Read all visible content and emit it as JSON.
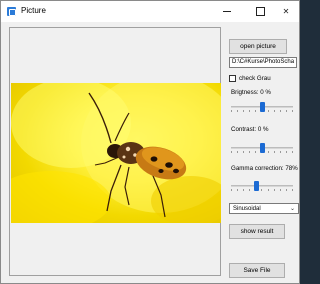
{
  "window": {
    "title": "Picture",
    "accent": "#2b7bd8"
  },
  "controls": {
    "open_picture_label": "open picture",
    "file_path": "D:\\C#Kurse\\PhotoScha",
    "grey_checkbox_label": "check Grau",
    "grey_checked": false,
    "brightness_label": "Brigtness: 0 %",
    "brightness_level": 0.5,
    "contrast_label": "Contrast: 0 %",
    "contrast_level": 0.5,
    "gamma_label": "Gamma correction: 78%",
    "gamma_level": 0.4,
    "filter_selected": "Sinusoidal",
    "show_result_label": "show result",
    "save_file_label": "Save File"
  },
  "icons": {
    "app": "picture-app-icon",
    "minimize": "minimize-icon",
    "maximize": "maximize-icon",
    "close": "close-icon",
    "dropdown": "chevron-down-icon"
  },
  "colors": {
    "slider_thumb": "#1b6ad3",
    "image_background": "#fff03a"
  }
}
